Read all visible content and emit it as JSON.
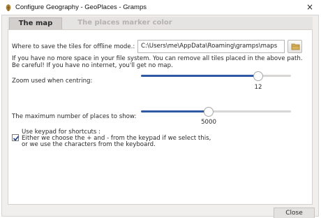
{
  "window": {
    "title": "Configure Geography - GeoPlaces - Gramps",
    "close_glyph": "×"
  },
  "tabs": [
    {
      "label": "The map",
      "active": true
    },
    {
      "label": "The places marker color",
      "active": false
    }
  ],
  "map_tab": {
    "tiles_label": "Where to save the tiles for offline mode.:",
    "tiles_path": "C:\\Users\\me\\AppData\\Roaming\\gramps\\maps",
    "info_line_1": "If you have no more space in your file system. You can remove all tiles placed in the above path.",
    "info_line_2": "Be careful! If you have no internet, you'll get no map.",
    "zoom_label": "Zoom used when centring:",
    "zoom": {
      "value": "12",
      "fraction": 0.8
    },
    "max_places_label": "The maximum number of places to show:",
    "max_places": {
      "value": "5000",
      "fraction": 0.45
    },
    "keypad": {
      "checked": true,
      "line_1": "Use keypad for shortcuts :",
      "line_2": "Either we choose the + and - from the keypad if we select this,",
      "line_3": "or we use the characters from the keyboard."
    }
  },
  "footer": {
    "close_label": "Close"
  },
  "colors": {
    "accent": "#2f58a5",
    "check": "#1f3f84"
  },
  "icons": {
    "app": "gramps-app-icon",
    "folder": "folder-icon",
    "check": "check-icon",
    "close": "close-icon"
  }
}
